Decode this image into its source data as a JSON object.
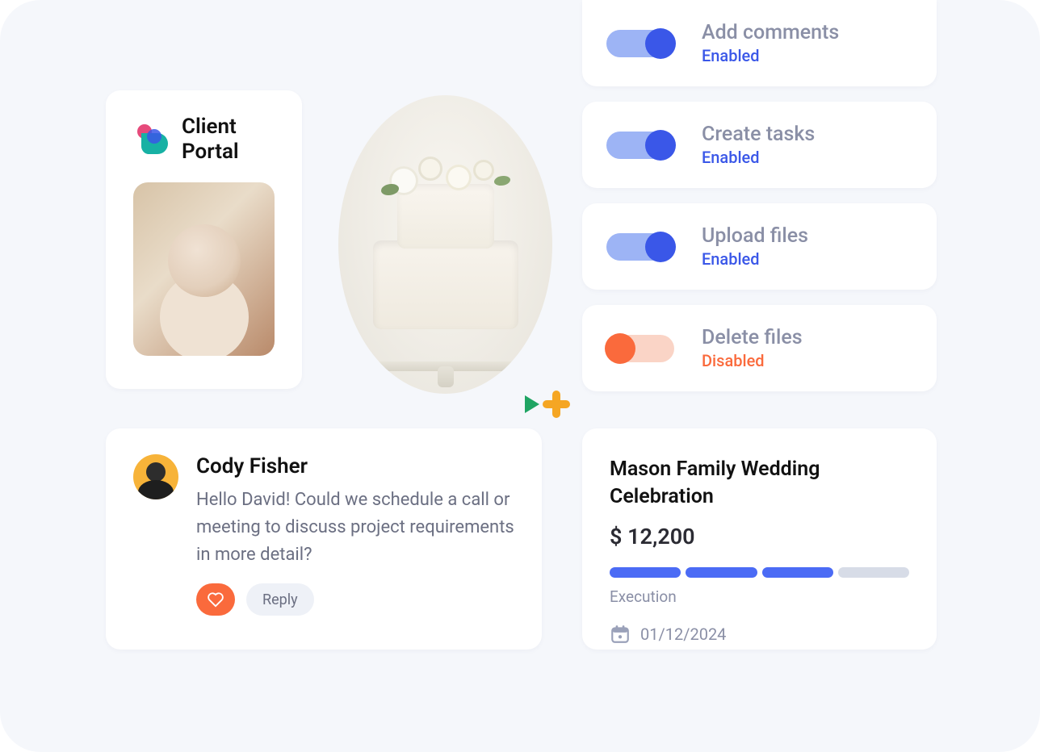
{
  "clientPortal": {
    "title": "Client Portal"
  },
  "permissions": [
    {
      "label": "Add comments",
      "status": "Enabled",
      "enabled": true
    },
    {
      "label": "Create tasks",
      "status": "Enabled",
      "enabled": true
    },
    {
      "label": "Upload files",
      "status": "Enabled",
      "enabled": true
    },
    {
      "label": "Delete files",
      "status": "Disabled",
      "enabled": false
    }
  ],
  "comment": {
    "author": "Cody Fisher",
    "message": "Hello David! Could we schedule a call or meeting to discuss project requirements in more detail?",
    "replyLabel": "Reply"
  },
  "project": {
    "title": "Mason Family Wedding Celebration",
    "amount": "$ 12,200",
    "stage": "Execution",
    "date": "01/12/2024",
    "progressSegments": 4,
    "progressFilled": 3
  }
}
